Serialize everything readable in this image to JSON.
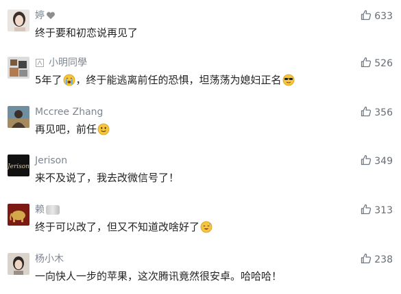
{
  "comments": [
    {
      "name": "婷",
      "text": "终于要和初恋说再见了",
      "likes": "633"
    },
    {
      "name": "小明同學",
      "text": "5年了",
      "text_after_emoji": "，终于能逃离前任的恐惧，坦荡荡为媳妇正名",
      "likes": "526"
    },
    {
      "name": "Mccree Zhang",
      "text": "再见吧，前任",
      "likes": "356"
    },
    {
      "name": "Jerison",
      "text": "来不及说了，我去改微信号了！",
      "likes": "349"
    },
    {
      "name": "赖",
      "text": "终于可以改了，但又不知道改啥好了",
      "likes": "313"
    },
    {
      "name": "杨小木",
      "text": "一向快人一步的苹果，这次腾讯竟然很安卓。哈哈哈！",
      "likes": "238"
    }
  ],
  "avatars": {
    "jerison_text": "Jerison"
  },
  "icons": {
    "like": "thumbs-up-icon",
    "heart": "heart-icon",
    "rank": "rank-icon",
    "emoji_crying": "crying-face-icon",
    "emoji_sunglasses": "sunglasses-face-icon",
    "emoji_smile": "smiling-face-icon",
    "emoji_sweat": "sweat-smile-icon"
  },
  "colors": {
    "name": "#7d8591",
    "text": "#222222",
    "like": "#666c75",
    "emoji_yellow": "#f6c53a"
  }
}
